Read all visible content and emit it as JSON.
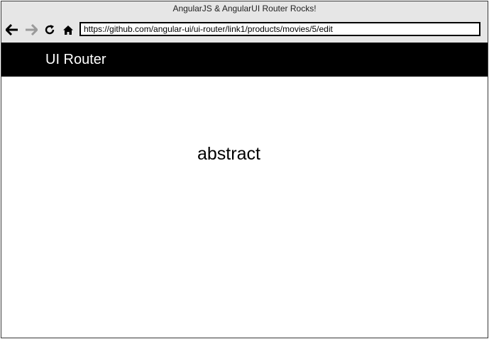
{
  "window": {
    "title": "AngularJS & AngularUI Router Rocks!"
  },
  "toolbar": {
    "back_icon": "arrow-left-icon",
    "forward_icon": "arrow-right-icon",
    "reload_icon": "reload-icon",
    "home_icon": "home-icon",
    "url": "https://github.com/angular-ui/ui-router/link1/products/movies/5/edit",
    "forward_color": "#9a9a9a"
  },
  "navbar": {
    "brand": "UI Router",
    "background": "#000000"
  },
  "main": {
    "text": "abstract"
  }
}
